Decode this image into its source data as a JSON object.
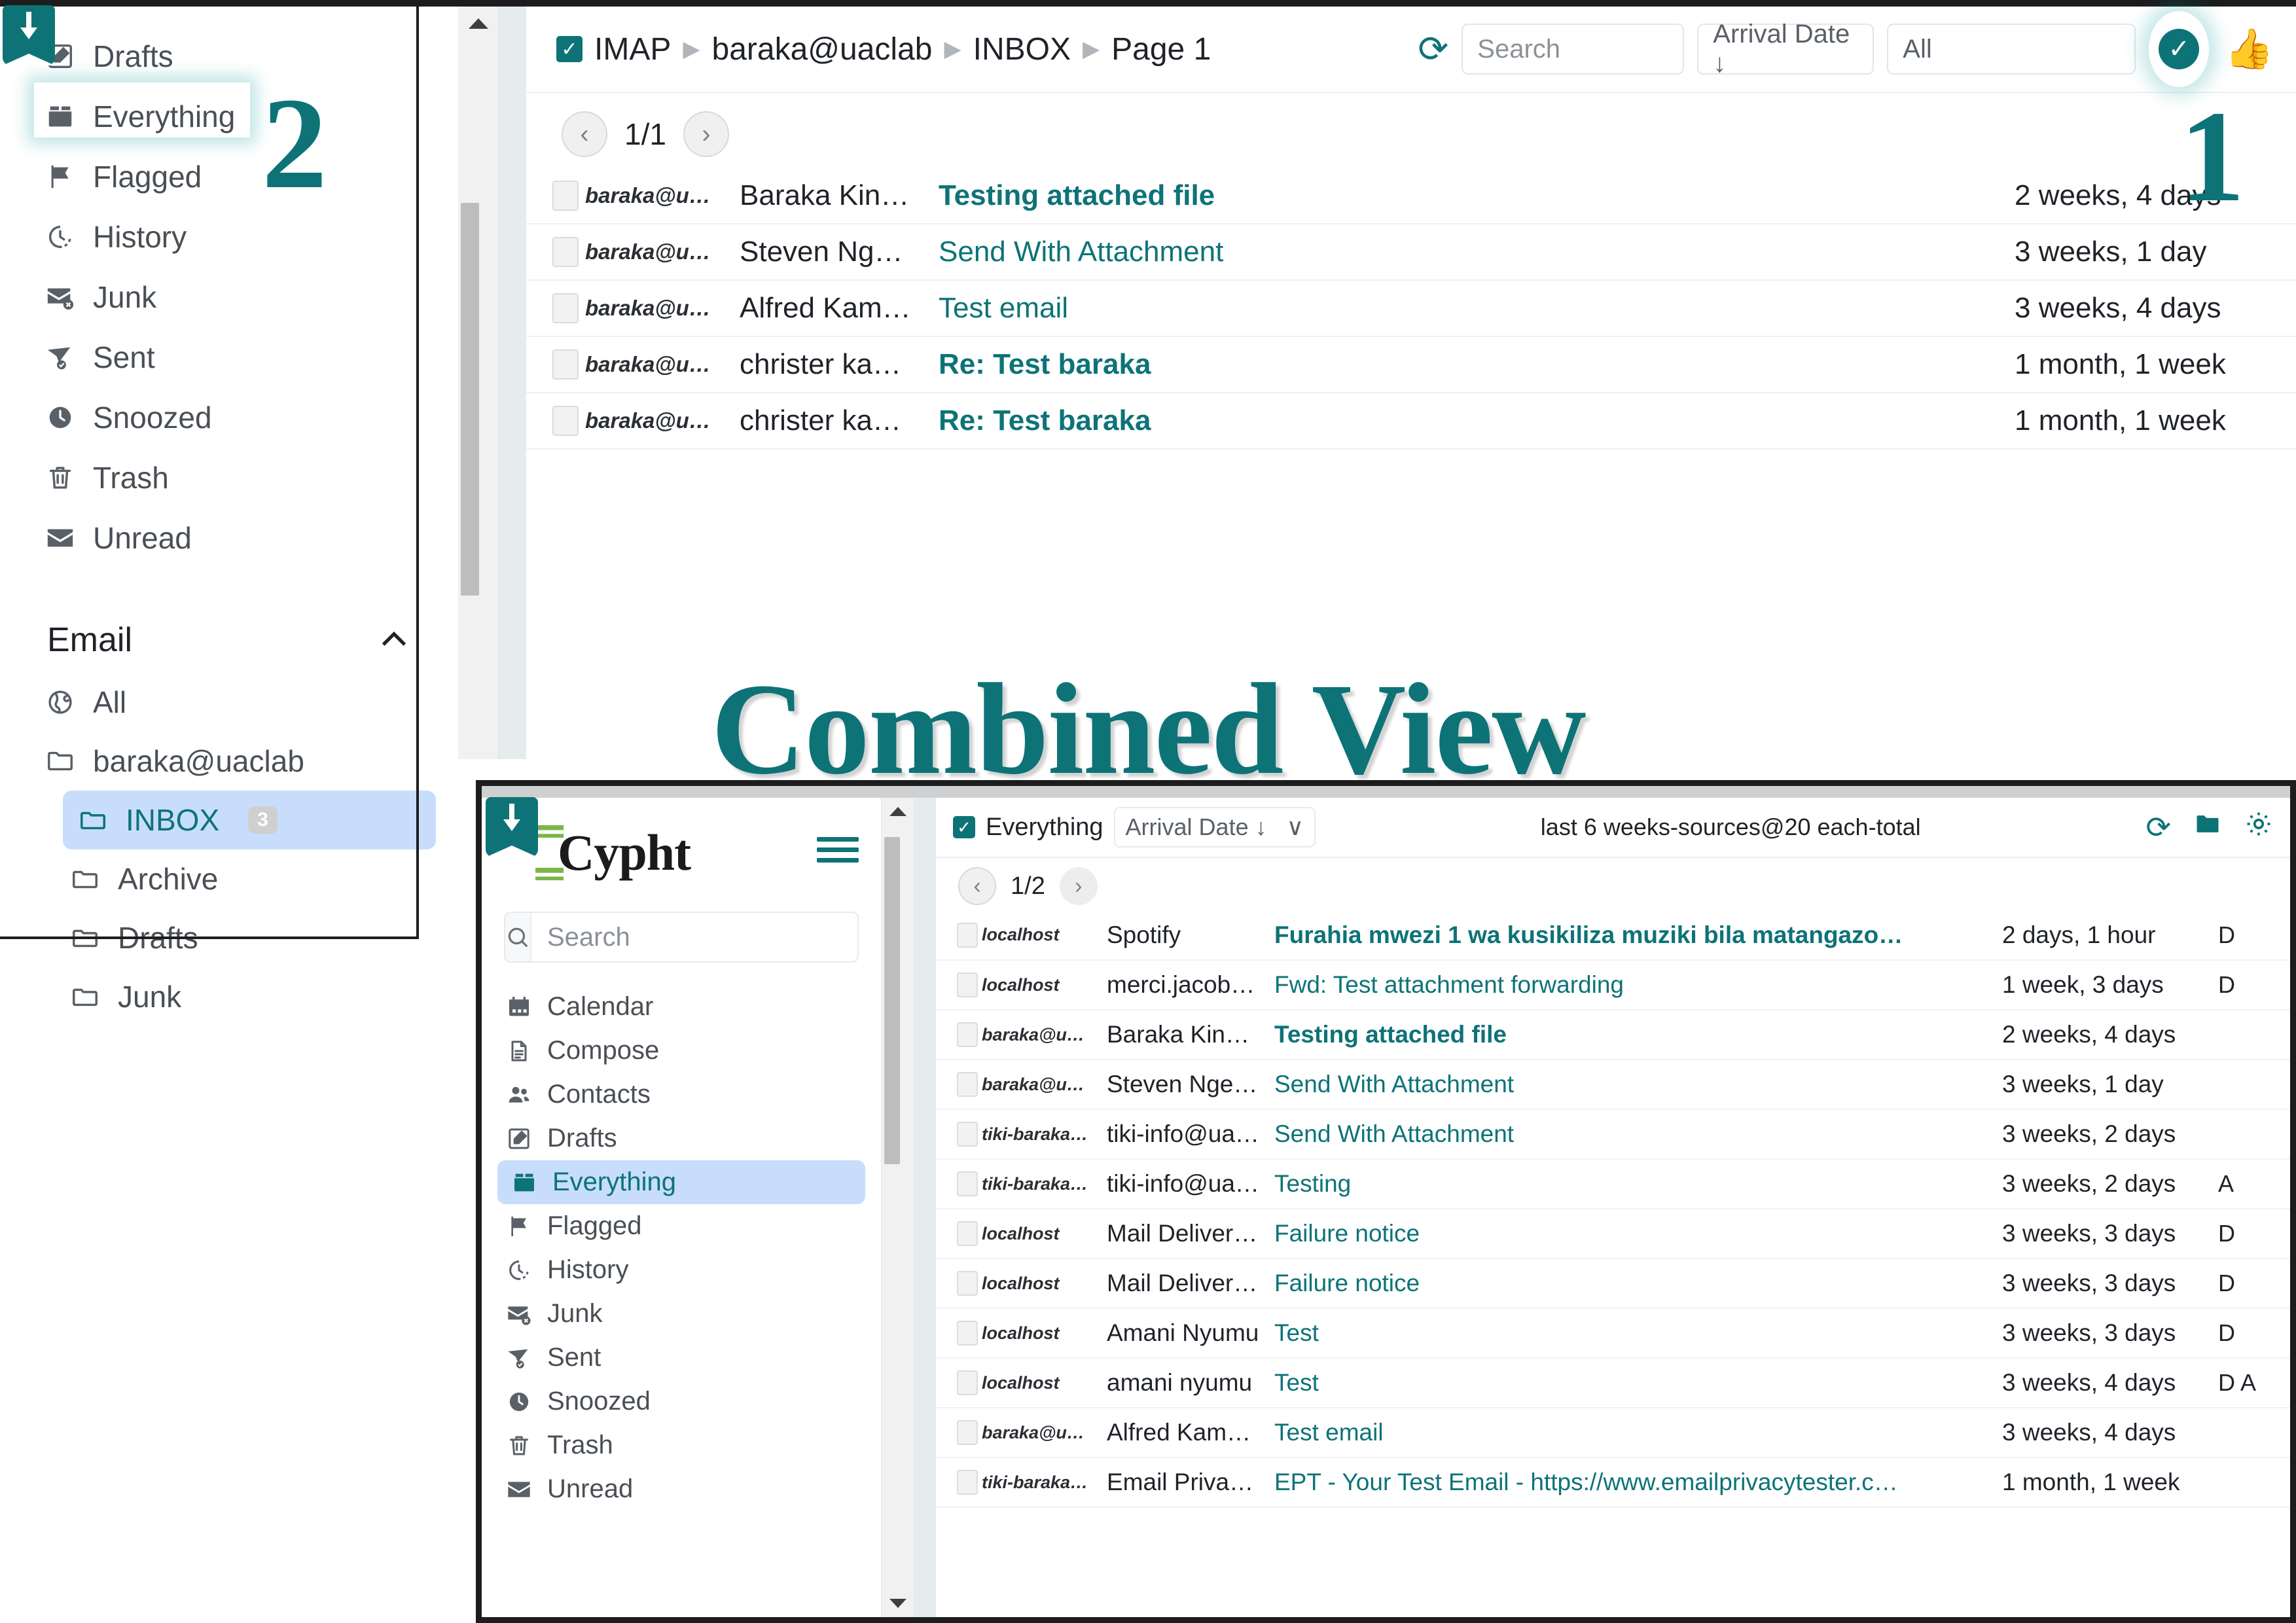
{
  "annotations": {
    "marker_one": "1",
    "marker_two": "2",
    "combined_view_title": "Combined View"
  },
  "top_panel": {
    "sidebar": {
      "items": [
        {
          "label": "Drafts",
          "icon": "drafts-icon"
        },
        {
          "label": "Everything",
          "icon": "everything-box-icon"
        },
        {
          "label": "Flagged",
          "icon": "flag-icon"
        },
        {
          "label": "History",
          "icon": "history-clock-icon"
        },
        {
          "label": "Junk",
          "icon": "junk-envelope-icon"
        },
        {
          "label": "Sent",
          "icon": "sent-paper-plane-icon"
        },
        {
          "label": "Snoozed",
          "icon": "snoozed-clock-icon"
        },
        {
          "label": "Trash",
          "icon": "trash-icon"
        },
        {
          "label": "Unread",
          "icon": "unread-envelope-icon"
        }
      ],
      "email_section": {
        "title": "Email",
        "collapse_icon": "chevron-up-icon"
      },
      "folders": [
        {
          "label": "All",
          "icon": "globe-icon",
          "indent": 0,
          "selected": false,
          "count": ""
        },
        {
          "label": "baraka@uaclab",
          "icon": "folder-icon",
          "indent": 0,
          "selected": false,
          "count": ""
        },
        {
          "label": "INBOX",
          "icon": "folder-open-icon",
          "indent": 1,
          "selected": true,
          "count": "3"
        },
        {
          "label": "Archive",
          "icon": "folder-open-icon",
          "indent": 1,
          "selected": false,
          "count": ""
        },
        {
          "label": "Drafts",
          "icon": "folder-open-icon",
          "indent": 1,
          "selected": false,
          "count": ""
        },
        {
          "label": "Junk",
          "icon": "folder-open-icon",
          "indent": 1,
          "selected": false,
          "count": ""
        }
      ]
    },
    "toolbar": {
      "checkbox_checked": true,
      "breadcrumbs": [
        "IMAP",
        "baraka@uaclab",
        "INBOX",
        "Page 1"
      ],
      "refresh_icon": "refresh-icon",
      "search_placeholder": "Search",
      "sort_value": "Arrival Date ↓",
      "filter_value": "All",
      "status_check_icon": "check-circle-icon",
      "thumbs_up_icon": "thumbs-up-icon"
    },
    "pager": {
      "prev": "‹",
      "label": "1/1",
      "next": "›"
    },
    "messages": [
      {
        "source": "baraka@u…",
        "from": "Baraka Kinywa",
        "subject": "Testing attached file",
        "date": "2 weeks, 4 days",
        "unread": true,
        "flags": ""
      },
      {
        "source": "baraka@u…",
        "from": "Steven Nges…",
        "subject": "Send With Attachment",
        "date": "3 weeks, 1 day",
        "unread": false,
        "flags": ""
      },
      {
        "source": "baraka@u…",
        "from": "Alfred Kambale",
        "subject": "Test email",
        "date": "3 weeks, 4 days",
        "unread": false,
        "flags": ""
      },
      {
        "source": "baraka@u…",
        "from": "christer kaha…",
        "subject": "Re: Test baraka",
        "date": "1 month, 1 week",
        "unread": true,
        "flags": ""
      },
      {
        "source": "baraka@u…",
        "from": "christer kaha…",
        "subject": "Re: Test baraka",
        "date": "1 month, 1 week",
        "unread": true,
        "flags": ""
      }
    ]
  },
  "bottom_panel": {
    "brand": {
      "name": "Cypht",
      "logo_icon": "cypht-logo-icon",
      "menu_icon": "hamburger-icon"
    },
    "search": {
      "placeholder": "Search",
      "icon": "search-icon",
      "value": ""
    },
    "sidebar_items": [
      {
        "label": "Calendar",
        "icon": "calendar-icon",
        "selected": false
      },
      {
        "label": "Compose",
        "icon": "compose-document-icon",
        "selected": false
      },
      {
        "label": "Contacts",
        "icon": "contacts-people-icon",
        "selected": false
      },
      {
        "label": "Drafts",
        "icon": "drafts-icon",
        "selected": false
      },
      {
        "label": "Everything",
        "icon": "everything-box-icon",
        "selected": true
      },
      {
        "label": "Flagged",
        "icon": "flag-icon",
        "selected": false
      },
      {
        "label": "History",
        "icon": "history-clock-icon",
        "selected": false
      },
      {
        "label": "Junk",
        "icon": "junk-envelope-icon",
        "selected": false
      },
      {
        "label": "Sent",
        "icon": "sent-paper-plane-icon",
        "selected": false
      },
      {
        "label": "Snoozed",
        "icon": "snoozed-clock-icon",
        "selected": false
      },
      {
        "label": "Trash",
        "icon": "trash-icon",
        "selected": false
      },
      {
        "label": "Unread",
        "icon": "unread-envelope-icon",
        "selected": false
      }
    ],
    "toolbar": {
      "checkbox_checked": true,
      "scope_label": "Everything",
      "sort_value": "Arrival Date ↓",
      "sort_caret": "∨",
      "status_text": "last 6 weeks-sources@20 each-total",
      "refresh_icon": "refresh-icon",
      "folder_icon": "folder-filled-icon",
      "settings_icon": "gear-icon"
    },
    "pager": {
      "prev": "‹",
      "label": "1/2",
      "next": "›"
    },
    "messages": [
      {
        "source": "localhost",
        "from": "Spotify",
        "subject": "Furahia mwezi 1 wa kusikiliza muziki bila matangazo…",
        "date": "2 days, 1 hour",
        "unread": true,
        "flags": "D"
      },
      {
        "source": "localhost",
        "from": "merci.jacob@…",
        "subject": "Fwd: Test attachment forwarding",
        "date": "1 week, 3 days",
        "unread": false,
        "flags": "D"
      },
      {
        "source": "baraka@u…",
        "from": "Baraka Kinywa",
        "subject": "Testing attached file",
        "date": "2 weeks, 4 days",
        "unread": true,
        "flags": ""
      },
      {
        "source": "baraka@u…",
        "from": "Steven Nges…",
        "subject": "Send With Attachment",
        "date": "3 weeks, 1 day",
        "unread": false,
        "flags": ""
      },
      {
        "source": "tiki-baraka…",
        "from": "tiki-info@uacl…",
        "subject": "Send With Attachment",
        "date": "3 weeks, 2 days",
        "unread": false,
        "flags": ""
      },
      {
        "source": "tiki-baraka…",
        "from": "tiki-info@uacl…",
        "subject": "Testing",
        "date": "3 weeks, 2 days",
        "unread": false,
        "flags": "A"
      },
      {
        "source": "localhost",
        "from": "Mail Delivery …",
        "subject": "Failure notice",
        "date": "3 weeks, 3 days",
        "unread": false,
        "flags": "D"
      },
      {
        "source": "localhost",
        "from": "Mail Delivery …",
        "subject": "Failure notice",
        "date": "3 weeks, 3 days",
        "unread": false,
        "flags": "D"
      },
      {
        "source": "localhost",
        "from": "Amani Nyumu",
        "subject": "Test",
        "date": "3 weeks, 3 days",
        "unread": false,
        "flags": "D"
      },
      {
        "source": "localhost",
        "from": "amani nyumu",
        "subject": "Test",
        "date": "3 weeks, 4 days",
        "unread": false,
        "flags": "D A"
      },
      {
        "source": "baraka@u…",
        "from": "Alfred Kambale",
        "subject": "Test email",
        "date": "3 weeks, 4 days",
        "unread": false,
        "flags": ""
      },
      {
        "source": "tiki-baraka…",
        "from": "Email Privacy…",
        "subject": "EPT - Your Test Email - https://www.emailprivacytester.c…",
        "date": "1 month, 1 week",
        "unread": false,
        "flags": ""
      }
    ]
  },
  "colors": {
    "accent": "#0d7377",
    "selection": "#c7ddfb",
    "text": "#1f2328",
    "muted": "#4a4f55"
  }
}
